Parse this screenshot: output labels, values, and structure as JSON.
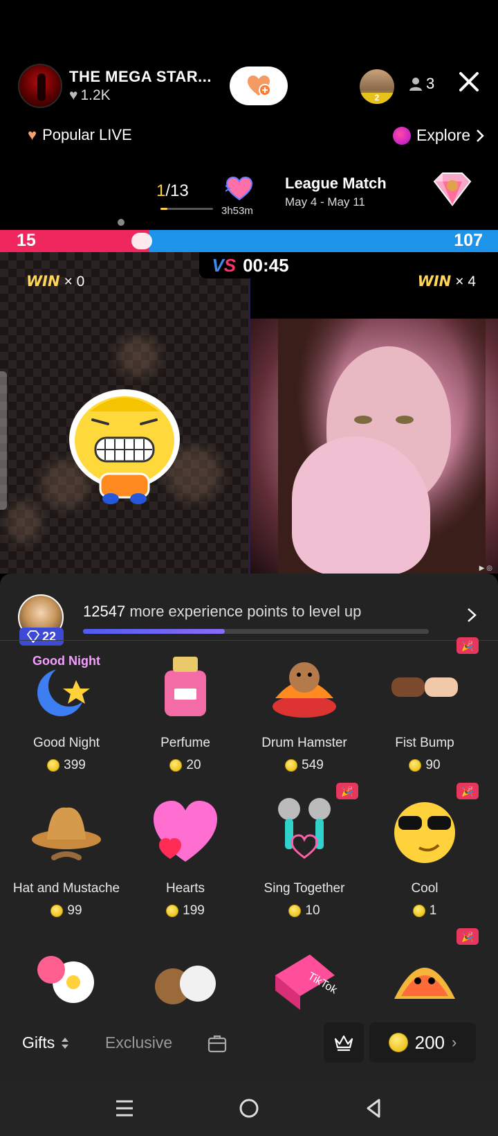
{
  "header": {
    "host_name": "THE MEGA STAR...",
    "host_likes": "1.2K",
    "top_viewer_rank": "2",
    "viewer_count": "3"
  },
  "nav": {
    "popular_label": "Popular LIVE",
    "explore_label": "Explore"
  },
  "league": {
    "rank_current": "1",
    "rank_total": "/13",
    "rank_progress": 0.13,
    "timer": "3h53m",
    "title": "League Match",
    "dates": "May 4 - May 11"
  },
  "battle": {
    "score_left": "15",
    "score_right": "107",
    "countdown": "00:45",
    "win_word": "WIN",
    "win_left": "× 0",
    "win_right": "× 4",
    "colors": {
      "left": "#f0275e",
      "right": "#1e93ea"
    }
  },
  "experience": {
    "points": "12547",
    "text": "more experience points to level up",
    "level": "22",
    "progress": 0.41
  },
  "gifts": [
    {
      "name": "Good Night",
      "price": "399",
      "icon": "good-night-moon-icon",
      "party": false
    },
    {
      "name": "Perfume",
      "price": "20",
      "icon": "perfume-icon",
      "party": false
    },
    {
      "name": "Drum Hamster",
      "price": "549",
      "icon": "drum-hamster-icon",
      "party": false
    },
    {
      "name": "Fist Bump",
      "price": "90",
      "icon": "fist-bump-icon",
      "party": true
    },
    {
      "name": "Hat and Mustache",
      "price": "99",
      "icon": "hat-mustache-icon",
      "party": false
    },
    {
      "name": "Hearts",
      "price": "199",
      "icon": "hearts-icon",
      "party": false
    },
    {
      "name": "Sing Together",
      "price": "10",
      "icon": "microphones-icon",
      "party": true
    },
    {
      "name": "Cool",
      "price": "1",
      "icon": "cool-sunglasses-icon",
      "party": true
    },
    {
      "name": "",
      "price": "",
      "icon": "flowers-icon",
      "party": false
    },
    {
      "name": "",
      "price": "",
      "icon": "bears-icon",
      "party": false
    },
    {
      "name": "",
      "price": "",
      "icon": "tiktok-box-icon",
      "party": false
    },
    {
      "name": "",
      "price": "",
      "icon": "taco-icon",
      "party": true
    }
  ],
  "tabbar": {
    "gifts_label": "Gifts",
    "exclusive_label": "Exclusive",
    "coins": "200"
  }
}
